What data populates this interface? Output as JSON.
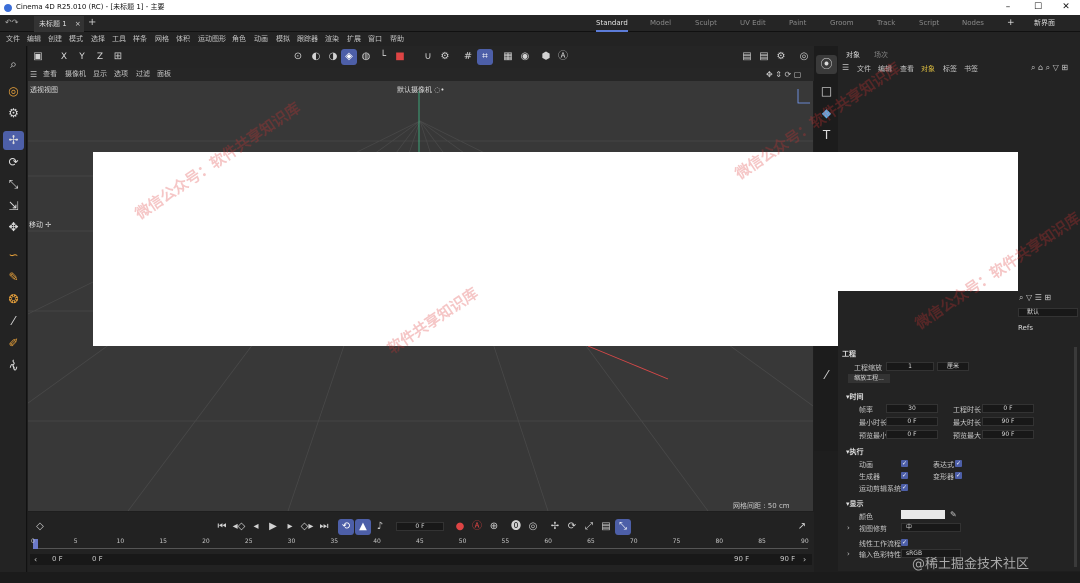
{
  "window": {
    "title": "Cinema 4D R25.010 (RC) - [未标题 1] - 主要",
    "minimize": "–",
    "maximize": "☐",
    "close": "✕"
  },
  "tabs": {
    "doc_tab": "未标题 1",
    "doc_close": "×",
    "add": "+",
    "workspaces": [
      "Standard",
      "Model",
      "Sculpt",
      "UV Edit",
      "Paint",
      "Groom",
      "Track",
      "Script",
      "Nodes"
    ],
    "ws_add": "+",
    "new_ui": "新界面"
  },
  "menubar": [
    "文件",
    "编辑",
    "创建",
    "模式",
    "选择",
    "工具",
    "样条",
    "网格",
    "体积",
    "运动图形",
    "角色",
    "动画",
    "模拟",
    "跟踪器",
    "渲染",
    "扩展",
    "窗口",
    "帮助"
  ],
  "topicons": {
    "x": "X",
    "y": "Y",
    "z": "Z"
  },
  "viewport": {
    "menu": [
      "查看",
      "摄像机",
      "显示",
      "选项",
      "过滤",
      "面板"
    ],
    "view_label": "透视视图",
    "camera_label": "默认摄像机 ◌•",
    "move_label": "移动 ✢",
    "grid_spacing": "网格间距 : 50 cm"
  },
  "objpanel": {
    "tabs": [
      "对象",
      "场次"
    ],
    "menu": [
      "文件",
      "编辑",
      "查看",
      "对象",
      "标签",
      "书签"
    ]
  },
  "attrpanel": {
    "mode": "默认",
    "refs": "Refs",
    "section_project": "工程",
    "project_scale_label": "工程缩放",
    "project_scale_value": "1",
    "project_scale_unit": "厘米",
    "scale_project_button": "缩放工程...",
    "section_time": "▾时间",
    "fps_label": "帧率",
    "fps_value": "30",
    "proj_len_label": "工程时长",
    "proj_len_value": "0 F",
    "min_time_label": "最小时长",
    "min_time_value": "0 F",
    "max_time_label": "最大时长",
    "max_time_value": "90 F",
    "preview_min_label": "预览最小",
    "preview_min_value": "0 F",
    "preview_max_label": "预览最大",
    "preview_max_value": "90 F",
    "section_exec": "▾执行",
    "anim_label": "动画",
    "expr_label": "表达式",
    "gen_label": "生成器",
    "deform_label": "变形器",
    "mograph_label": "运动剪辑系统",
    "section_display": "▾显示",
    "color_label": "颜色",
    "view_clip_label": "视图修剪",
    "view_clip_value": "中",
    "linear_wf_label": "线性工作流程",
    "input_color_label": "输入色彩特性",
    "input_color_value": "sRGB"
  },
  "timeline": {
    "current_frame": "0 F",
    "ticks": [
      "0",
      "5",
      "10",
      "15",
      "20",
      "25",
      "30",
      "35",
      "40",
      "45",
      "50",
      "55",
      "60",
      "65",
      "70",
      "75",
      "80",
      "85",
      "90"
    ],
    "start": "0 F",
    "start2": "0 F",
    "end": "90 F",
    "end2": "90 F",
    "playhead_fraction": 0.0
  },
  "watermark": {
    "text1": "微信公众号：软件共享知识库",
    "text2": "软件共享知识库",
    "corner": "@稀土掘金技术社区"
  },
  "colors": {
    "accent": "#4d5fa8",
    "bg": "#1e1e1e",
    "viewport": "#383838"
  }
}
